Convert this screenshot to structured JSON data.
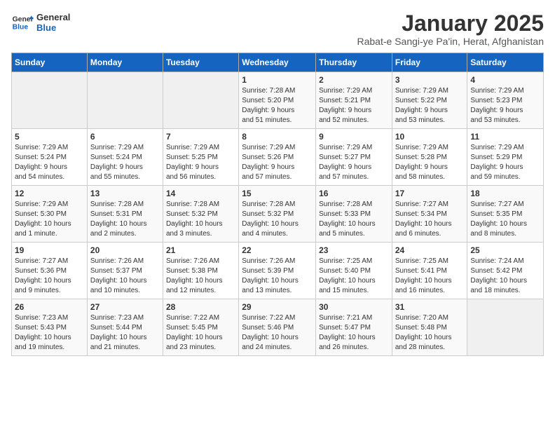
{
  "header": {
    "logo_general": "General",
    "logo_blue": "Blue",
    "title": "January 2025",
    "subtitle": "Rabat-e Sangi-ye Pa'in, Herat, Afghanistan"
  },
  "weekdays": [
    "Sunday",
    "Monday",
    "Tuesday",
    "Wednesday",
    "Thursday",
    "Friday",
    "Saturday"
  ],
  "weeks": [
    [
      {
        "day": "",
        "detail": ""
      },
      {
        "day": "",
        "detail": ""
      },
      {
        "day": "",
        "detail": ""
      },
      {
        "day": "1",
        "detail": "Sunrise: 7:28 AM\nSunset: 5:20 PM\nDaylight: 9 hours\nand 51 minutes."
      },
      {
        "day": "2",
        "detail": "Sunrise: 7:29 AM\nSunset: 5:21 PM\nDaylight: 9 hours\nand 52 minutes."
      },
      {
        "day": "3",
        "detail": "Sunrise: 7:29 AM\nSunset: 5:22 PM\nDaylight: 9 hours\nand 53 minutes."
      },
      {
        "day": "4",
        "detail": "Sunrise: 7:29 AM\nSunset: 5:23 PM\nDaylight: 9 hours\nand 53 minutes."
      }
    ],
    [
      {
        "day": "5",
        "detail": "Sunrise: 7:29 AM\nSunset: 5:24 PM\nDaylight: 9 hours\nand 54 minutes."
      },
      {
        "day": "6",
        "detail": "Sunrise: 7:29 AM\nSunset: 5:24 PM\nDaylight: 9 hours\nand 55 minutes."
      },
      {
        "day": "7",
        "detail": "Sunrise: 7:29 AM\nSunset: 5:25 PM\nDaylight: 9 hours\nand 56 minutes."
      },
      {
        "day": "8",
        "detail": "Sunrise: 7:29 AM\nSunset: 5:26 PM\nDaylight: 9 hours\nand 57 minutes."
      },
      {
        "day": "9",
        "detail": "Sunrise: 7:29 AM\nSunset: 5:27 PM\nDaylight: 9 hours\nand 57 minutes."
      },
      {
        "day": "10",
        "detail": "Sunrise: 7:29 AM\nSunset: 5:28 PM\nDaylight: 9 hours\nand 58 minutes."
      },
      {
        "day": "11",
        "detail": "Sunrise: 7:29 AM\nSunset: 5:29 PM\nDaylight: 9 hours\nand 59 minutes."
      }
    ],
    [
      {
        "day": "12",
        "detail": "Sunrise: 7:29 AM\nSunset: 5:30 PM\nDaylight: 10 hours\nand 1 minute."
      },
      {
        "day": "13",
        "detail": "Sunrise: 7:28 AM\nSunset: 5:31 PM\nDaylight: 10 hours\nand 2 minutes."
      },
      {
        "day": "14",
        "detail": "Sunrise: 7:28 AM\nSunset: 5:32 PM\nDaylight: 10 hours\nand 3 minutes."
      },
      {
        "day": "15",
        "detail": "Sunrise: 7:28 AM\nSunset: 5:32 PM\nDaylight: 10 hours\nand 4 minutes."
      },
      {
        "day": "16",
        "detail": "Sunrise: 7:28 AM\nSunset: 5:33 PM\nDaylight: 10 hours\nand 5 minutes."
      },
      {
        "day": "17",
        "detail": "Sunrise: 7:27 AM\nSunset: 5:34 PM\nDaylight: 10 hours\nand 6 minutes."
      },
      {
        "day": "18",
        "detail": "Sunrise: 7:27 AM\nSunset: 5:35 PM\nDaylight: 10 hours\nand 8 minutes."
      }
    ],
    [
      {
        "day": "19",
        "detail": "Sunrise: 7:27 AM\nSunset: 5:36 PM\nDaylight: 10 hours\nand 9 minutes."
      },
      {
        "day": "20",
        "detail": "Sunrise: 7:26 AM\nSunset: 5:37 PM\nDaylight: 10 hours\nand 10 minutes."
      },
      {
        "day": "21",
        "detail": "Sunrise: 7:26 AM\nSunset: 5:38 PM\nDaylight: 10 hours\nand 12 minutes."
      },
      {
        "day": "22",
        "detail": "Sunrise: 7:26 AM\nSunset: 5:39 PM\nDaylight: 10 hours\nand 13 minutes."
      },
      {
        "day": "23",
        "detail": "Sunrise: 7:25 AM\nSunset: 5:40 PM\nDaylight: 10 hours\nand 15 minutes."
      },
      {
        "day": "24",
        "detail": "Sunrise: 7:25 AM\nSunset: 5:41 PM\nDaylight: 10 hours\nand 16 minutes."
      },
      {
        "day": "25",
        "detail": "Sunrise: 7:24 AM\nSunset: 5:42 PM\nDaylight: 10 hours\nand 18 minutes."
      }
    ],
    [
      {
        "day": "26",
        "detail": "Sunrise: 7:23 AM\nSunset: 5:43 PM\nDaylight: 10 hours\nand 19 minutes."
      },
      {
        "day": "27",
        "detail": "Sunrise: 7:23 AM\nSunset: 5:44 PM\nDaylight: 10 hours\nand 21 minutes."
      },
      {
        "day": "28",
        "detail": "Sunrise: 7:22 AM\nSunset: 5:45 PM\nDaylight: 10 hours\nand 23 minutes."
      },
      {
        "day": "29",
        "detail": "Sunrise: 7:22 AM\nSunset: 5:46 PM\nDaylight: 10 hours\nand 24 minutes."
      },
      {
        "day": "30",
        "detail": "Sunrise: 7:21 AM\nSunset: 5:47 PM\nDaylight: 10 hours\nand 26 minutes."
      },
      {
        "day": "31",
        "detail": "Sunrise: 7:20 AM\nSunset: 5:48 PM\nDaylight: 10 hours\nand 28 minutes."
      },
      {
        "day": "",
        "detail": ""
      }
    ]
  ]
}
